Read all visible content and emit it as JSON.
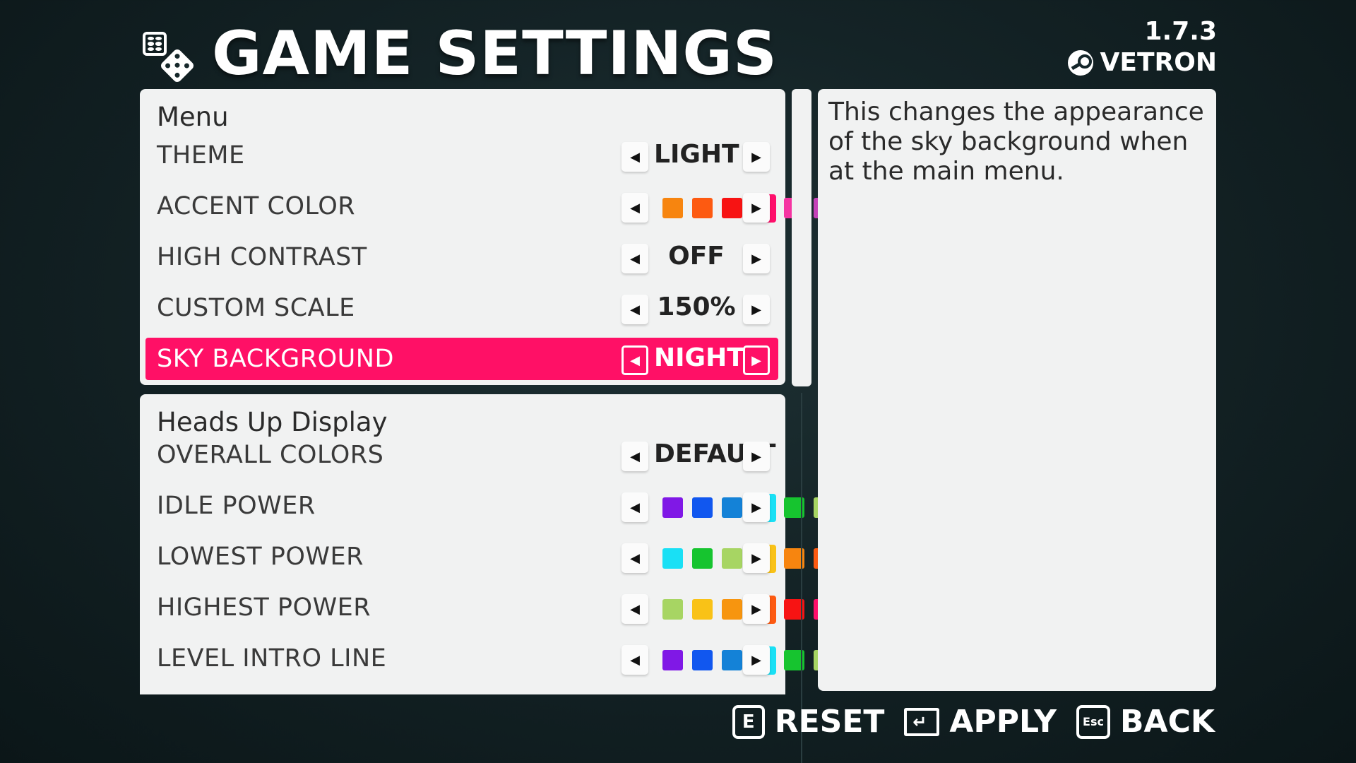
{
  "header": {
    "title": "GAME SETTINGS",
    "version": "1.7.3",
    "profile_name": "VETRON",
    "icons": [
      "dice-icon",
      "steam-icon"
    ]
  },
  "menu_section": {
    "title": "Menu",
    "rows": [
      {
        "label": "THEME",
        "value": "LIGHT"
      },
      {
        "label": "ACCENT COLOR",
        "colors": [
          "#f7850f",
          "#fd5a11",
          "#f71313",
          "#ff0f6b",
          "#f535a2",
          "#c542b8",
          "#a34ec4"
        ],
        "selected_index": 3
      },
      {
        "label": "HIGH CONTRAST",
        "value": "OFF"
      },
      {
        "label": "CUSTOM SCALE",
        "value": "150%"
      },
      {
        "label": "SKY BACKGROUND",
        "value": "NIGHT",
        "selected": true
      }
    ]
  },
  "hud_section": {
    "title": "Heads Up Display",
    "rows": [
      {
        "label": "OVERALL COLORS",
        "value": "DEFAULT"
      },
      {
        "label": "IDLE POWER",
        "colors": [
          "#8018e6",
          "#1157ef",
          "#1482d7",
          "#19e0f5",
          "#16c42f",
          "#a7d563",
          "#f9c217"
        ],
        "selected_index": 3
      },
      {
        "label": "LOWEST POWER",
        "colors": [
          "#19e0f5",
          "#16c42f",
          "#a7d563",
          "#f9c217",
          "#f7850f",
          "#fd5a11",
          "#f71313"
        ],
        "selected_index": 3
      },
      {
        "label": "HIGHEST POWER",
        "colors": [
          "#a7d563",
          "#f9c217",
          "#f7950f",
          "#fd5a11",
          "#f71313",
          "#ff0f6b",
          "#f535a2"
        ],
        "selected_index": 3
      },
      {
        "label": "LEVEL INTRO LINE",
        "colors": [
          "#8018e6",
          "#1157ef",
          "#1482d7",
          "#19e0f5",
          "#16c42f",
          "#a7d563",
          "#f9c217"
        ],
        "selected_index": 3
      }
    ]
  },
  "description": {
    "text": "This changes the appearance of the sky background when at the main menu."
  },
  "footer": {
    "reset": {
      "key": "E",
      "label": "RESET"
    },
    "apply": {
      "key": "enter",
      "label": "APPLY"
    },
    "back": {
      "key": "Esc",
      "label": "BACK"
    }
  },
  "arrows": {
    "left": "◀",
    "right": "▶"
  },
  "accent_color": "#ff1066"
}
